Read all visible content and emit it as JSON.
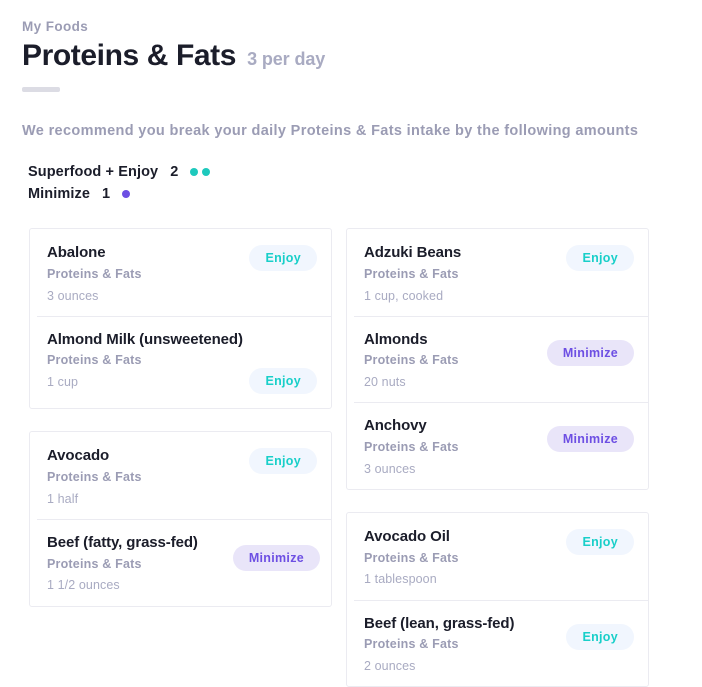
{
  "header": {
    "breadcrumb": "My Foods",
    "title": "Proteins & Fats",
    "per_day": "3 per day"
  },
  "recommendation": {
    "text": "We recommend you break your daily Proteins & Fats intake by the following amounts",
    "legend": [
      {
        "label": "Superfood + Enjoy",
        "count": "2",
        "dots": 2,
        "type": "enjoy"
      },
      {
        "label": "Minimize",
        "count": "1",
        "dots": 1,
        "type": "minimize"
      }
    ]
  },
  "colors": {
    "enjoy_text": "#19cfc9",
    "enjoy_bg": "#f1f6fe",
    "minimize_text": "#6d4fe3",
    "minimize_bg": "#e9e5f9",
    "title": "#1b1d2a",
    "muted": "#9b9cb4"
  },
  "columns": [
    {
      "cards": [
        {
          "rows": [
            {
              "name": "Abalone",
              "category": "Proteins & Fats",
              "amount": "3 ounces",
              "badge": "Enjoy",
              "badge_type": "enjoy"
            },
            {
              "name": "Almond Milk (unsweetened)",
              "category": "Proteins & Fats",
              "amount": "1 cup",
              "badge": "Enjoy",
              "badge_type": "enjoy"
            }
          ]
        },
        {
          "rows": [
            {
              "name": "Avocado",
              "category": "Proteins & Fats",
              "amount": "1 half",
              "badge": "Enjoy",
              "badge_type": "enjoy"
            },
            {
              "name": "Beef (fatty, grass-fed)",
              "category": "Proteins & Fats",
              "amount": "1 1/2 ounces",
              "badge": "Minimize",
              "badge_type": "minimize"
            }
          ]
        }
      ]
    },
    {
      "cards": [
        {
          "rows": [
            {
              "name": "Adzuki Beans",
              "category": "Proteins & Fats",
              "amount": "1 cup, cooked",
              "badge": "Enjoy",
              "badge_type": "enjoy"
            },
            {
              "name": "Almonds",
              "category": "Proteins & Fats",
              "amount": "20 nuts",
              "badge": "Minimize",
              "badge_type": "minimize"
            },
            {
              "name": "Anchovy",
              "category": "Proteins & Fats",
              "amount": "3 ounces",
              "badge": "Minimize",
              "badge_type": "minimize"
            }
          ]
        },
        {
          "rows": [
            {
              "name": "Avocado Oil",
              "category": "Proteins & Fats",
              "amount": "1 tablespoon",
              "badge": "Enjoy",
              "badge_type": "enjoy"
            },
            {
              "name": "Beef (lean, grass-fed)",
              "category": "Proteins & Fats",
              "amount": "2 ounces",
              "badge": "Enjoy",
              "badge_type": "enjoy"
            }
          ]
        }
      ]
    }
  ]
}
